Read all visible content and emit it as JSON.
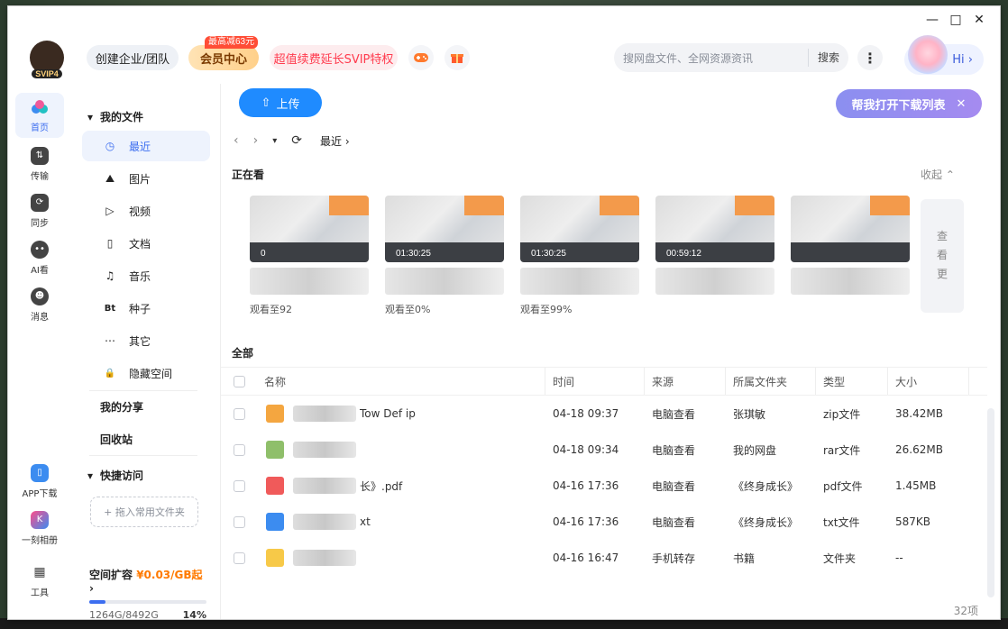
{
  "window": {
    "controls": {
      "minimize": "—",
      "maximize": "□",
      "close": "✕"
    }
  },
  "header": {
    "avatar_badge": "SVIP4",
    "enterprise": "创建企业/团队",
    "vip_tag": "最高减63元",
    "vip": "会员中心",
    "svip_promo": "超值续费延长SVIP特权",
    "search_placeholder": "搜网盘文件、全网资源资讯",
    "search_button": "搜索",
    "hi": "Hi"
  },
  "leftnav": [
    {
      "label": "首页",
      "icon": "cloud-icon"
    },
    {
      "label": "传输",
      "icon": "transfer-icon"
    },
    {
      "label": "同步",
      "icon": "sync-icon"
    },
    {
      "label": "AI看",
      "icon": "ai-icon"
    },
    {
      "label": "消息",
      "icon": "message-icon"
    },
    {
      "label": "APP下载",
      "icon": "phone-icon"
    },
    {
      "label": "一刻相册",
      "icon": "album-icon"
    },
    {
      "label": "工具",
      "icon": "tools-icon"
    }
  ],
  "sidebar": {
    "my_files": "我的文件",
    "items": [
      {
        "label": "最近",
        "glyph": "◷"
      },
      {
        "label": "图片",
        "glyph": "⛰"
      },
      {
        "label": "视频",
        "glyph": "▷"
      },
      {
        "label": "文档",
        "glyph": "▯"
      },
      {
        "label": "音乐",
        "glyph": "♫"
      },
      {
        "label": "种子",
        "glyph": "Bt"
      },
      {
        "label": "其它",
        "glyph": "⋯"
      },
      {
        "label": "隐藏空间",
        "glyph": "🔒"
      }
    ],
    "my_share": "我的分享",
    "recycle": "回收站",
    "quick": "快捷访问",
    "dropzone": "+ 拖入常用文件夹",
    "quota_title": "空间扩容",
    "quota_price": "¥0.03/GB起",
    "quota_used": "1264G/8492G",
    "quota_pct": "14%",
    "quota_fraction": 0.14
  },
  "main": {
    "upload": "上传",
    "helper": "帮我打开下载列表",
    "breadcrumb": "最近",
    "watching": "正在看",
    "collapse": "收起",
    "see_more": [
      "查",
      "看",
      "更"
    ],
    "all": "全部",
    "count": "32项",
    "thumbs": [
      {
        "time": "0",
        "caption": "观看至92"
      },
      {
        "time": "01:30:25",
        "caption": "观看至0%"
      },
      {
        "time": "01:30:25",
        "caption": "观看至99%"
      },
      {
        "time": "00:59:12",
        "caption": ""
      },
      {
        "time": "",
        "caption": ""
      }
    ],
    "columns": [
      "名称",
      "时间",
      "来源",
      "所属文件夹",
      "类型",
      "大小"
    ],
    "rows": [
      {
        "name": "Tow    Def            ip",
        "time": "04-18 09:37",
        "src": "电脑查看",
        "dir": "张琪敏",
        "type": "zip文件",
        "size": "38.42MB",
        "color": "#f4a640"
      },
      {
        "name": "",
        "time": "04-18 09:34",
        "src": "电脑查看",
        "dir": "我的网盘",
        "type": "rar文件",
        "size": "26.62MB",
        "color": "#8fbf6a"
      },
      {
        "name": "长》.pdf",
        "time": "04-16 17:36",
        "src": "电脑查看",
        "dir": "《终身成长》",
        "type": "pdf文件",
        "size": "1.45MB",
        "color": "#f05a5a"
      },
      {
        "name": "xt",
        "time": "04-16 17:36",
        "src": "电脑查看",
        "dir": "《终身成长》",
        "type": "txt文件",
        "size": "587KB",
        "color": "#3c8cf0"
      },
      {
        "name": "",
        "time": "04-16 16:47",
        "src": "手机转存",
        "dir": "书籍",
        "type": "文件夹",
        "size": "--",
        "color": "#f7c948"
      }
    ]
  }
}
